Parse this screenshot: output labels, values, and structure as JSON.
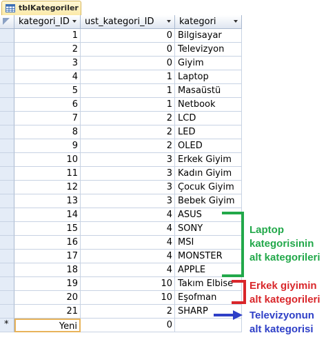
{
  "tab": {
    "title": "tblKategoriler",
    "icon": "table-icon"
  },
  "columns": [
    "kategori_ID",
    "ust_kategori_ID",
    "kategori"
  ],
  "rows": [
    {
      "id": "1",
      "parent": "0",
      "name": "Bilgisayar"
    },
    {
      "id": "2",
      "parent": "0",
      "name": "Televizyon"
    },
    {
      "id": "3",
      "parent": "0",
      "name": "Giyim"
    },
    {
      "id": "4",
      "parent": "1",
      "name": "Laptop"
    },
    {
      "id": "5",
      "parent": "1",
      "name": "Masaüstü"
    },
    {
      "id": "6",
      "parent": "1",
      "name": "Netbook"
    },
    {
      "id": "7",
      "parent": "2",
      "name": "LCD"
    },
    {
      "id": "8",
      "parent": "2",
      "name": "LED"
    },
    {
      "id": "9",
      "parent": "2",
      "name": "OLED"
    },
    {
      "id": "10",
      "parent": "3",
      "name": "Erkek Giyim"
    },
    {
      "id": "11",
      "parent": "3",
      "name": "Kadın Giyim"
    },
    {
      "id": "12",
      "parent": "3",
      "name": "Çocuk Giyim"
    },
    {
      "id": "13",
      "parent": "3",
      "name": "Bebek Giyim"
    },
    {
      "id": "14",
      "parent": "4",
      "name": "ASUS"
    },
    {
      "id": "15",
      "parent": "4",
      "name": "SONY"
    },
    {
      "id": "16",
      "parent": "4",
      "name": "MSI"
    },
    {
      "id": "17",
      "parent": "4",
      "name": "MONSTER"
    },
    {
      "id": "18",
      "parent": "4",
      "name": "APPLE"
    },
    {
      "id": "19",
      "parent": "10",
      "name": "Takım Elbise"
    },
    {
      "id": "20",
      "parent": "10",
      "name": "Eşofman"
    },
    {
      "id": "21",
      "parent": "2",
      "name": "SHARP"
    }
  ],
  "new_row": {
    "marker": "*",
    "id": "Yeni",
    "parent": "0",
    "name": ""
  },
  "annotations": {
    "laptop": {
      "lines": [
        "Laptop",
        "kategorisinin",
        "alt kategorileri"
      ],
      "color": "#22a84a"
    },
    "erkek": {
      "lines": [
        "Erkek giyimin",
        "alt kategorileri"
      ],
      "color": "#d9262a"
    },
    "tv": {
      "lines": [
        "Televizyonun",
        "alt kategorisi"
      ],
      "color": "#2e3fc7"
    }
  },
  "colors": {
    "header_bg": "#dfe6f1",
    "grid_line": "#c7d2e3",
    "tab_bg": "#fbe9a8",
    "selected_border": "#e8b35a"
  }
}
